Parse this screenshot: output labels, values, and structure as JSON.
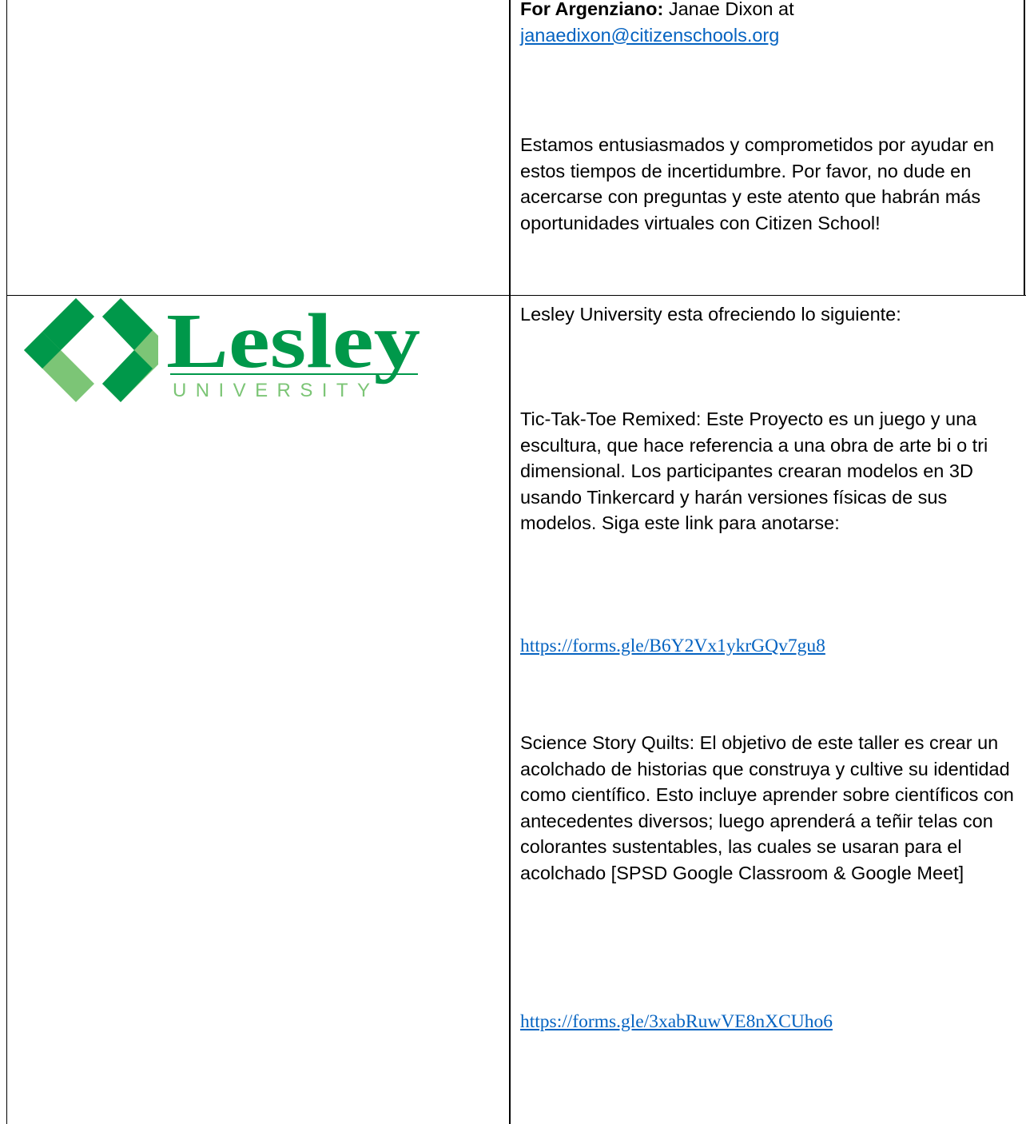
{
  "row1": {
    "contact_label": "For Argenziano:",
    "contact_name": " Janae Dixon at",
    "contact_email": "janaedixon@citizenschools.org",
    "closing_paragraph": "Estamos entusiasmados y comprometidos por ayudar en estos tiempos de incertidumbre. Por favor, no dude en acercarse con preguntas y este atento que habrán más oportunidades virtuales con Citizen School!"
  },
  "row2": {
    "logo": {
      "wordmark": "Lesley",
      "subtitle": "UNIVERSITY",
      "colors": {
        "dark_green": "#00984a",
        "light_green": "#7cc576"
      }
    },
    "intro": "Lesley University esta ofreciendo lo siguiente:",
    "program1_description": "Tic-Tak-Toe Remixed: Este Proyecto es un juego y una escultura, que hace referencia a una obra de arte bi o tri dimensional. Los participantes crearan modelos en 3D usando Tinkercard y harán versiones físicas de sus modelos. Siga este link para anotarse:",
    "program1_link": "https://forms.gle/B6Y2Vx1ykrGQv7gu8",
    "program2_description": "Science Story Quilts: El objetivo de este taller es crear un acolchado de historias que construya y cultive su identidad como científico. Esto incluye aprender sobre científicos con antecedentes diversos; luego aprenderá a teñir telas con colorantes sustentables, las cuales se usaran para el acolchado [SPSD Google Classroom & Google Meet]",
    "program2_link": "https://forms.gle/3xabRuwVE8nXCUho6"
  },
  "colors": {
    "link": "#0563c1",
    "border": "#000000"
  }
}
